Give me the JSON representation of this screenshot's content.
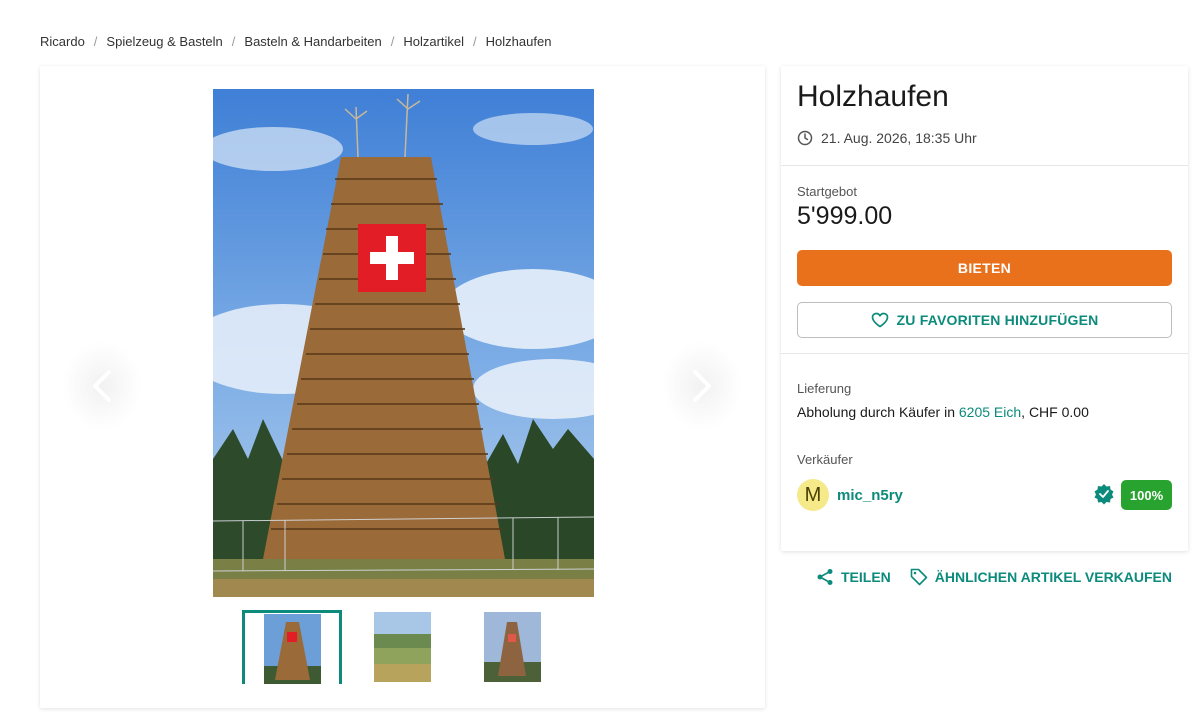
{
  "breadcrumb": {
    "items": [
      "Ricardo",
      "Spielzeug & Basteln",
      "Basteln & Handarbeiten",
      "Holzartikel",
      "Holzhaufen"
    ],
    "separator": "/"
  },
  "gallery": {
    "thumbnail_count": 3,
    "active_thumbnail": 1
  },
  "listing": {
    "title": "Holzhaufen",
    "end_time": "21. Aug. 2026, 18:35 Uhr",
    "price_label": "Startgebot",
    "price": "5'999.00",
    "bid_button": "BIETEN",
    "favorite_button": "ZU FAVORITEN HINZUFÜGEN",
    "delivery_label": "Lieferung",
    "delivery_prefix": "Abholung durch Käufer in ",
    "delivery_location": "6205 Eich",
    "delivery_suffix": ", CHF 0.00",
    "seller_label": "Verkäufer",
    "seller_initial": "M",
    "seller_name": "mic_n5ry",
    "seller_rating": "100%"
  },
  "actions": {
    "share": "TEILEN",
    "sell_similar": "ÄHNLICHEN ARTIKEL VERKAUFEN"
  },
  "colors": {
    "accent": "#0c8b7c",
    "bid": "#e9711c",
    "rating": "#29a32f",
    "avatar": "#f6e98a"
  },
  "icons": [
    "clock-icon",
    "heart-icon",
    "chevron-left-icon",
    "chevron-right-icon",
    "verified-badge-icon",
    "share-icon",
    "tag-icon"
  ]
}
